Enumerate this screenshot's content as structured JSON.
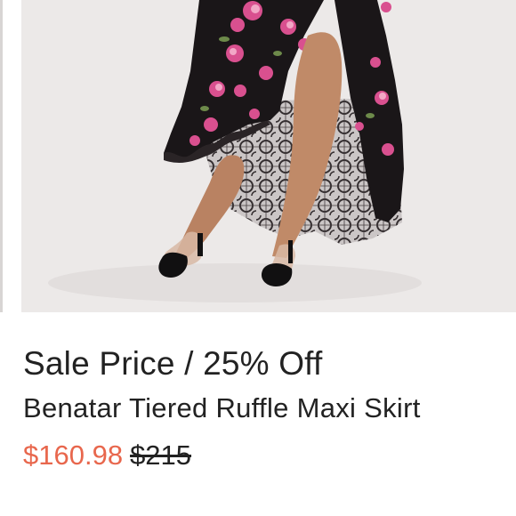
{
  "colors": {
    "photo_background": "#ece9e8",
    "sale_price": "#e8674d",
    "text": "#222222",
    "skirt_base": "#1a1618",
    "flower_pink": "#d9508f"
  },
  "product": {
    "image_alt": "Model wearing a black lace floral high-low ruffle maxi skirt with black and clear pumps",
    "promo_label": "Sale Price / 25% Off",
    "title": "Benatar Tiered Ruffle Maxi Skirt",
    "sale_price": "$160.98",
    "original_price": "$215"
  }
}
